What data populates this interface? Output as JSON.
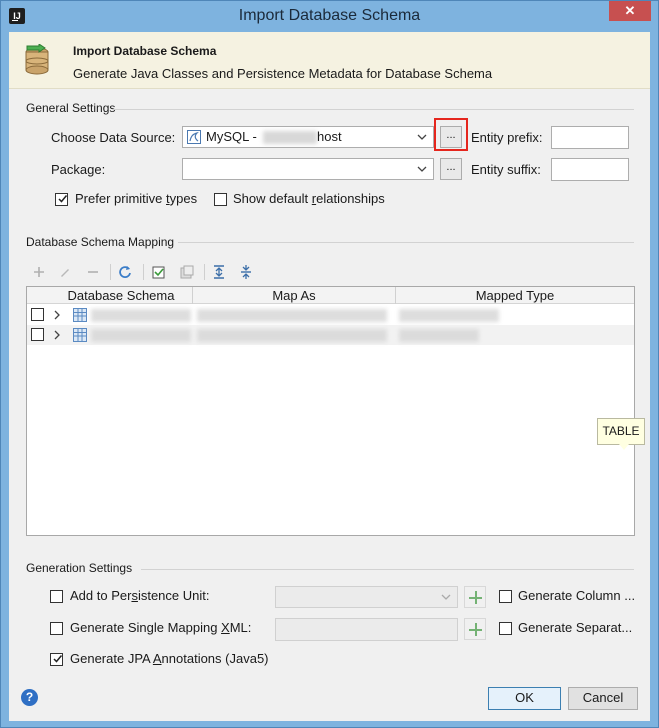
{
  "window": {
    "title": "Import Database Schema",
    "app_icon": "intellij-icon",
    "close_glyph": "✕"
  },
  "banner": {
    "title": "Import Database Schema",
    "subtitle": "Generate Java Classes and Persistence Metadata for Database Schema"
  },
  "general": {
    "section_title": "General Settings",
    "datasource_label": "Choose Data Source:",
    "datasource_value_prefix": "MySQL - ",
    "datasource_value_suffix": "host",
    "browse_label": "...",
    "package_label": "Package:",
    "package_browse_label": "...",
    "entity_prefix_label": "Entity prefix:",
    "entity_suffix_label": "Entity suffix:",
    "prefer_primitive": {
      "label_a": "Prefer primitive ",
      "label_u": "t",
      "label_b": "ypes",
      "checked": true
    },
    "show_default_rel": {
      "label_a": "Show default ",
      "label_u": "r",
      "label_b": "elationships",
      "checked": false
    }
  },
  "mapping": {
    "section_title": "Database Schema Mapping",
    "columns": [
      "Database Schema",
      "Map As",
      "Mapped Type"
    ],
    "rows": [
      {
        "checked": false,
        "expanded": false
      },
      {
        "checked": false,
        "expanded": false
      }
    ],
    "tooltip": "TABLE"
  },
  "generation": {
    "section_title": "Generation Settings",
    "add_persistence": {
      "label_a": "Add to Per",
      "label_u": "s",
      "label_b": "istence Unit:",
      "checked": false
    },
    "single_mapping": {
      "label_a": "Generate Single Mapping ",
      "label_u": "X",
      "label_b": "ML:",
      "checked": false
    },
    "jpa": {
      "label_a": "Generate JPA ",
      "label_u": "A",
      "label_b": "nnotations (Java5)",
      "checked": true
    },
    "gen_column": {
      "label": "Generate Column ...",
      "checked": false
    },
    "gen_separate": {
      "label": "Generate Separat...",
      "checked": false
    }
  },
  "footer": {
    "help_glyph": "?",
    "ok_label": "OK",
    "cancel_label": "Cancel"
  }
}
